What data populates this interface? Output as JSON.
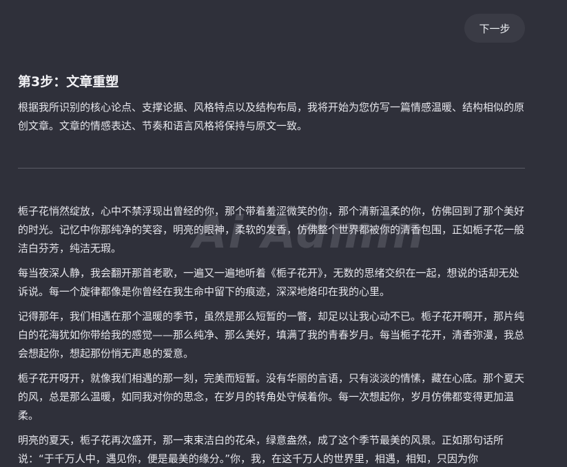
{
  "header": {
    "next_label": "下一步"
  },
  "step": {
    "title": "第3步：文章重塑",
    "intro": "根据我所识别的核心论点、支撑论据、风格特点以及结构布局，我将开始为您仿写一篇情感温暖、结构相似的原创文章。文章的情感表达、节奏和语言风格将保持与原文一致。"
  },
  "article": {
    "paragraphs": [
      "栀子花悄然绽放，心中不禁浮现出曾经的你，那个带着羞涩微笑的你，那个清新温柔的你，仿佛回到了那个美好的时光。记忆中你那纯净的笑容，明亮的眼神，柔软的发香，仿佛整个世界都被你的清香包围，正如栀子花一般洁白芬芳，纯洁无瑕。",
      "每当夜深人静，我会翻开那首老歌，一遍又一遍地听着《栀子花开》，无数的思绪交织在一起，想说的话却无处诉说。每一个旋律都像是你曾经在我生命中留下的痕迹，深深地烙印在我的心里。",
      "记得那年，我们相遇在那个温暖的季节，虽然是那么短暂的一瞥，却足以让我心动不已。栀子花开啊开，那片纯白的花海犹如你带给我的感觉——那么纯净、那么美好，填满了我的青春岁月。每当栀子花开，清香弥漫，我总会想起你，想起那份悄无声息的爱意。",
      "栀子花开呀开，就像我们相遇的那一刻，完美而短暂。没有华丽的言语，只有淡淡的情愫，藏在心底。那个夏天的风，总是那么温暖，如同我对你的思念，在岁月的转角处守候着你。每一次想起你，岁月仿佛都变得更加温柔。",
      "明亮的夏天，栀子花再次盛开，那一束束洁白的花朵，绿意盎然，成了这个季节最美的风景。正如那句话所说：“于千万人中，遇见你，便是最美的缘分。”你，我，在这千万人的世界里，相遇，相知，只因为你"
    ]
  },
  "watermark": {
    "text": "Ai Admin"
  }
}
